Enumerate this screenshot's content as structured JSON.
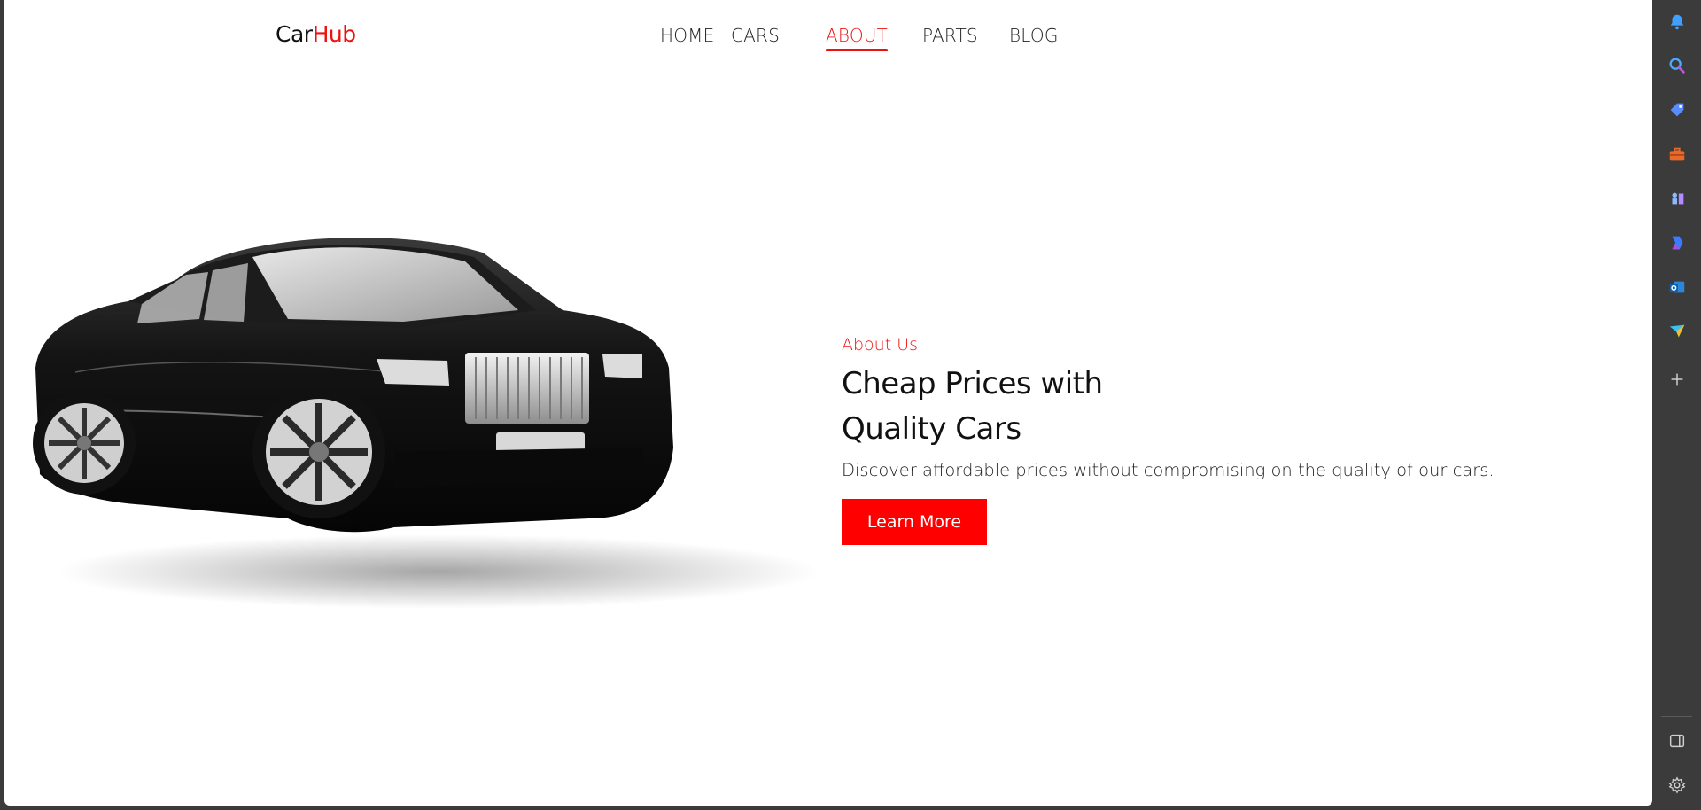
{
  "brand": {
    "logo_part1": "Car",
    "logo_part2": "Hub",
    "accent": "#ee1111"
  },
  "nav": {
    "items": [
      {
        "label": "HOME"
      },
      {
        "label": "CARS"
      },
      {
        "label": "ABOUT",
        "active": true
      },
      {
        "label": "PARTS"
      },
      {
        "label": "BLOG"
      }
    ]
  },
  "hero": {
    "image_alt": "black luxury car",
    "kicker": "About Us",
    "title_line1": "Cheap Prices with",
    "title_line2": "Quality Cars",
    "description": "Discover affordable prices without compromising on the quality of our cars.",
    "button_label": "Learn More",
    "button_color": "#ff0000"
  },
  "sidebar": {
    "icons": [
      "bell-icon",
      "search-icon",
      "tag-icon",
      "briefcase-icon",
      "chess-icon",
      "copilot-icon",
      "outlook-icon",
      "send-icon",
      "add-icon",
      "split-view-icon",
      "settings-icon"
    ]
  }
}
